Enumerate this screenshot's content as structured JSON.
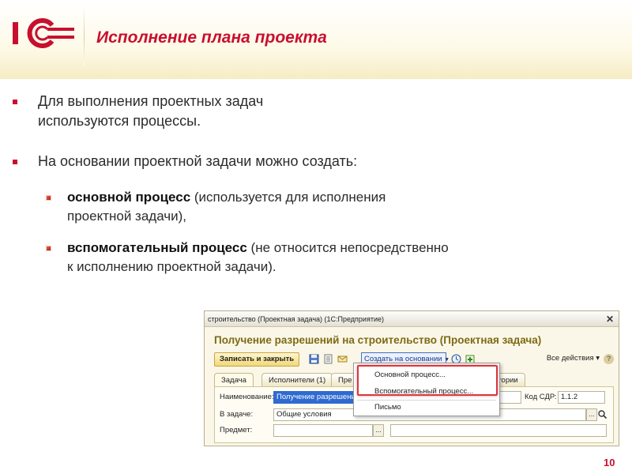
{
  "header": {
    "title": "Исполнение плана проекта",
    "brand": "1С"
  },
  "bullets": [
    {
      "text": "Для выполнения проектных задач\nиспользуются процессы."
    },
    {
      "text": "На основании проектной задачи можно создать:"
    }
  ],
  "sub_bullets": [
    {
      "bold": "основной процесс",
      "rest": " (используется для исполнения\nпроектной задачи),"
    },
    {
      "bold": "вспомогательный процесс",
      "rest": " (не относится непосредственно\nк исполнению проектной задачи)."
    }
  ],
  "window": {
    "title": "строительство (Проектная задача)  (1С:Предприятие)",
    "close_glyph": "✕",
    "form_title": "Получение разрешений на строительство (Проектная задача)",
    "toolbar": {
      "primary": "Записать и закрыть",
      "create_based": "Создать на основании",
      "all_actions": "Все действия ▾",
      "help": "?"
    },
    "tabs": [
      "Задача",
      "Исполнители (1)",
      "Пре",
      "егории"
    ],
    "fields": {
      "name_label": "Наименование:",
      "name_value": "Получение разрешений",
      "code_label": "Код СДР:",
      "code_value": "1.1.2",
      "task_label": "В задаче:",
      "task_value": "Общие условия",
      "subject_label": "Предмет:",
      "dots": "..."
    },
    "menu": {
      "items": [
        "Основной процесс...",
        "Вспомогательный процесс...",
        "Письмо"
      ]
    }
  },
  "page_number": "10",
  "icons": {
    "toolbar": [
      "save-icon",
      "list-icon",
      "mail-icon",
      "clock-icon",
      "add-icon"
    ],
    "lookup": "magnifier-icon"
  },
  "colors": {
    "accent": "#c8102e",
    "form_title": "#7d6a15"
  }
}
